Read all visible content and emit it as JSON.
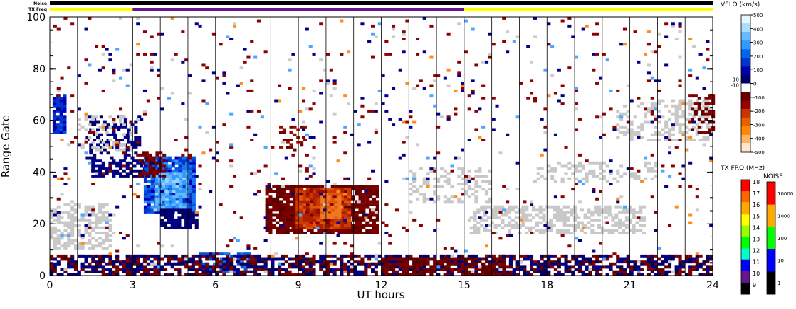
{
  "top_bars": {
    "noise_label": "Noise",
    "txfreq_label": "TX Freq"
  },
  "chart_data": {
    "type": "heatmap",
    "title": "",
    "xlabel": "UT hours",
    "ylabel": "Range Gate",
    "xlim": [
      0,
      24
    ],
    "ylim": [
      0,
      100
    ],
    "x_ticks": [
      "0",
      "3",
      "6",
      "9",
      "12",
      "15",
      "18",
      "21",
      "24"
    ],
    "y_ticks": [
      "0",
      "20",
      "40",
      "60",
      "80",
      "100"
    ],
    "hour_lines": [
      1,
      2,
      3,
      4,
      5,
      6,
      7,
      8,
      9,
      10,
      11,
      12,
      13,
      14,
      15,
      16,
      17,
      18,
      19,
      20,
      21,
      22,
      23
    ],
    "tx_freq_segments": [
      {
        "start": 0,
        "end": 3,
        "color": "#ffff00"
      },
      {
        "start": 3,
        "end": 15,
        "color": "#66168c"
      },
      {
        "start": 15,
        "end": 24,
        "color": "#ffff00"
      }
    ],
    "noise_bar_color": "#000000",
    "clusters": [
      {
        "kind": "pos",
        "x0": 0.1,
        "x1": 0.6,
        "y0": 55,
        "y1": 70,
        "vmin": 0.6,
        "vmax": 0.8,
        "density": 0.85
      },
      {
        "kind": "pos",
        "x0": 1.3,
        "x1": 3.2,
        "y0": 45,
        "y1": 62,
        "vmin": 0.85,
        "vmax": 1.0,
        "density": 0.4
      },
      {
        "kind": "gray",
        "x0": 1.0,
        "x1": 3.0,
        "y0": 48,
        "y1": 62,
        "density": 0.3
      },
      {
        "kind": "pos",
        "x0": 1.5,
        "x1": 3.8,
        "y0": 38,
        "y1": 45,
        "vmin": 0.85,
        "vmax": 1.0,
        "density": 0.65
      },
      {
        "kind": "pos",
        "x0": 3.4,
        "x1": 5.2,
        "y0": 24,
        "y1": 46,
        "vmin": 0.35,
        "vmax": 0.8,
        "density": 0.92
      },
      {
        "kind": "pos",
        "x0": 3.8,
        "x1": 5.0,
        "y0": 26,
        "y1": 40,
        "vmin": 0.15,
        "vmax": 0.4,
        "density": 0.9
      },
      {
        "kind": "neg",
        "x0": 3.2,
        "x1": 4.2,
        "y0": 38,
        "y1": 48,
        "vmin": 0.85,
        "vmax": 1.0,
        "density": 0.55
      },
      {
        "kind": "pos",
        "x0": 4.0,
        "x1": 5.3,
        "y0": 18,
        "y1": 26,
        "vmin": 0.9,
        "vmax": 1.0,
        "density": 0.75
      },
      {
        "kind": "gray",
        "x0": 0.0,
        "x1": 2.2,
        "y0": 10,
        "y1": 28,
        "density": 0.6
      },
      {
        "kind": "pos",
        "x0": 5.4,
        "x1": 7.2,
        "y0": 1,
        "y1": 9,
        "vmin": 0.4,
        "vmax": 0.6,
        "density": 0.6
      },
      {
        "kind": "neg",
        "x0": 7.8,
        "x1": 11.9,
        "y0": 16,
        "y1": 35,
        "vmin": 0.85,
        "vmax": 1.0,
        "density": 0.85
      },
      {
        "kind": "neg",
        "x0": 8.9,
        "x1": 10.9,
        "y0": 18,
        "y1": 34,
        "vmin": 0.45,
        "vmax": 0.75,
        "density": 0.95
      },
      {
        "kind": "neg",
        "x0": 9.8,
        "x1": 10.5,
        "y0": 22,
        "y1": 32,
        "vmin": 0.3,
        "vmax": 0.45,
        "density": 0.9
      },
      {
        "kind": "neg",
        "x0": 8.3,
        "x1": 9.3,
        "y0": 48,
        "y1": 58,
        "vmin": 0.7,
        "vmax": 0.95,
        "density": 0.3
      },
      {
        "kind": "gray",
        "x0": 15.2,
        "x1": 21.5,
        "y0": 16,
        "y1": 27,
        "density": 0.55
      },
      {
        "kind": "gray",
        "x0": 13.0,
        "x1": 16.0,
        "y0": 28,
        "y1": 42,
        "density": 0.3
      },
      {
        "kind": "gray",
        "x0": 17.5,
        "x1": 22.0,
        "y0": 36,
        "y1": 44,
        "density": 0.3
      },
      {
        "kind": "gray",
        "x0": 20.5,
        "x1": 24.0,
        "y0": 52,
        "y1": 68,
        "density": 0.35
      },
      {
        "kind": "neg",
        "x0": 23.2,
        "x1": 24.0,
        "y0": 55,
        "y1": 70,
        "vmin": 0.85,
        "vmax": 1.0,
        "density": 0.4
      },
      {
        "kind": "neg",
        "x0": 0.0,
        "x1": 24.0,
        "y0": 0,
        "y1": 8,
        "vmin": 0.9,
        "vmax": 1.0,
        "density": 0.45
      },
      {
        "kind": "pos",
        "x0": 0.0,
        "x1": 24.0,
        "y0": 0,
        "y1": 8,
        "vmin": 0.9,
        "vmax": 1.0,
        "density": 0.35
      },
      {
        "kind": "neg",
        "x0": 12.0,
        "x1": 16.5,
        "y0": 0,
        "y1": 7,
        "vmin": 0.9,
        "vmax": 1.0,
        "density": 0.55
      },
      {
        "kind": "scatter",
        "x0": 0.0,
        "x1": 24.0,
        "y0": 0,
        "y1": 100,
        "density": 0.04
      }
    ],
    "velocity_scale": {
      "label": "VELO (km/s)",
      "ticks": [
        "500",
        "400",
        "300",
        "200",
        "100",
        "0",
        "-100",
        "-200",
        "-300",
        "-400",
        "-500"
      ],
      "side_ticks": [
        "10",
        "-10"
      ],
      "colors": [
        "#ffe6cc",
        "#ffb366",
        "#ff8800",
        "#e66000",
        "#cc3300",
        "#990000",
        "#660000",
        "#ffffff",
        "#000066",
        "#0000aa",
        "#0033cc",
        "#0066ee",
        "#3399ff",
        "#66bbff",
        "#aaddff",
        "#e6f5ff"
      ]
    },
    "tx_freq_scale": {
      "label": "TX FRQ (MHz)",
      "ticks": [
        "18",
        "17",
        "16",
        "15",
        "14",
        "13",
        "12",
        "11",
        "10",
        "9"
      ],
      "colors": [
        "#ff0000",
        "#ff6600",
        "#ffaa00",
        "#ffff00",
        "#99ff00",
        "#00ff00",
        "#00ffcc",
        "#0000ff",
        "#66168c",
        "#000000"
      ]
    },
    "noise_scale": {
      "label": "NOISE",
      "ticks": [
        "10000",
        "1000",
        "100",
        "10",
        "1"
      ],
      "colors": [
        "#ff0000",
        "#ffaa00",
        "#00ff00",
        "#0000ff",
        "#000000"
      ]
    }
  }
}
